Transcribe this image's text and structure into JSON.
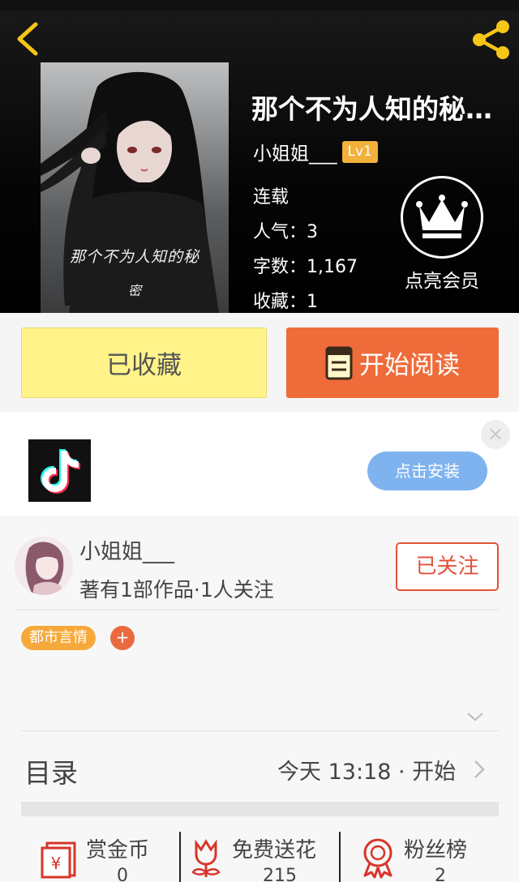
{
  "book": {
    "title": "那个不为人知的秘…",
    "cover_text_line1": "那个不为人知的秘",
    "cover_text_line2": "密",
    "author": "小姐姐___",
    "level": "Lv1",
    "status": "连载",
    "popularity": "人气：3",
    "word_count": "字数：1,167",
    "favorites": "收藏：1",
    "vip_label": "点亮会员"
  },
  "actions": {
    "favorited_label": "已收藏",
    "read_label": "开始阅读"
  },
  "ad": {
    "install_label": "点击安装",
    "close_glyph": "×"
  },
  "author_card": {
    "name": "小姐姐___",
    "info": "著有1部作品·1人关注",
    "follow_label": "已关注",
    "tag": "都市言情",
    "tag_add": "+"
  },
  "toc": {
    "title": "目录",
    "update": "今天 13:18 · 开始"
  },
  "stats": [
    {
      "label": "赏金币",
      "value": "0"
    },
    {
      "label": "免费送花",
      "value": "215"
    },
    {
      "label": "粉丝榜",
      "value": "2"
    }
  ],
  "colors": {
    "accent_orange": "#ef6c3a",
    "fav_yellow": "#fff38a",
    "follow_red": "#e2533a",
    "tag_orange": "#f6a93b",
    "install_blue": "#7fb3ef",
    "icon_gold": "#f5c518"
  },
  "icons": [
    "back-arrow-icon",
    "share-icon",
    "crown-icon",
    "book-icon",
    "tiktok-icon",
    "close-icon",
    "chevron-down-icon",
    "chevron-right-icon",
    "red-envelope-icon",
    "flower-icon",
    "medal-icon"
  ]
}
